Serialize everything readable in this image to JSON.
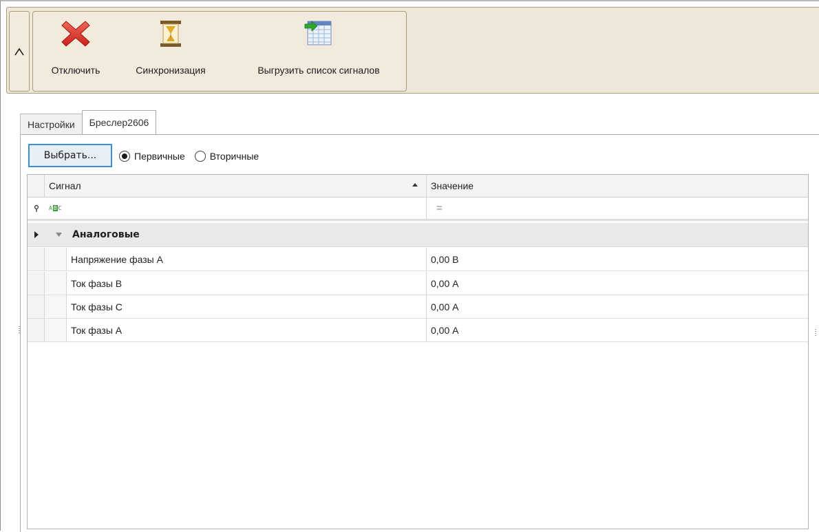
{
  "ribbon": {
    "collapse_label": "^",
    "buttons": [
      {
        "label": "Отключить",
        "icon": "disconnect-x-icon"
      },
      {
        "label": "Синхронизация",
        "icon": "hourglass-icon"
      },
      {
        "label": "Выгрузить список сигналов",
        "icon": "export-table-icon"
      }
    ]
  },
  "tabs": [
    {
      "label": "Настройки",
      "active": false
    },
    {
      "label": "Бреслер2606",
      "active": true
    }
  ],
  "toolbar": {
    "choose_label": "Выбрать...",
    "radio": [
      {
        "label": "Первичные",
        "checked": true
      },
      {
        "label": "Вторичные",
        "checked": false
      }
    ]
  },
  "grid": {
    "columns": {
      "signal": "Сигнал",
      "value": "Значение"
    },
    "filter": {
      "signal_icon": "abc-filter-icon",
      "value_symbol": "="
    },
    "group": {
      "label": "Аналоговые"
    },
    "rows": [
      {
        "signal": "Напряжение фазы A",
        "value": "0,00 В"
      },
      {
        "signal": "Ток фазы B",
        "value": "0,00 А"
      },
      {
        "signal": "Ток фазы C",
        "value": "0,00 А"
      },
      {
        "signal": "Ток фазы A",
        "value": "0,00 А"
      }
    ]
  },
  "colors": {
    "ribbon_bg": "#efe8d9",
    "ribbon_border": "#a89a7a",
    "accent": "#3c8ed3",
    "group_bg": "#e9e9e9"
  }
}
